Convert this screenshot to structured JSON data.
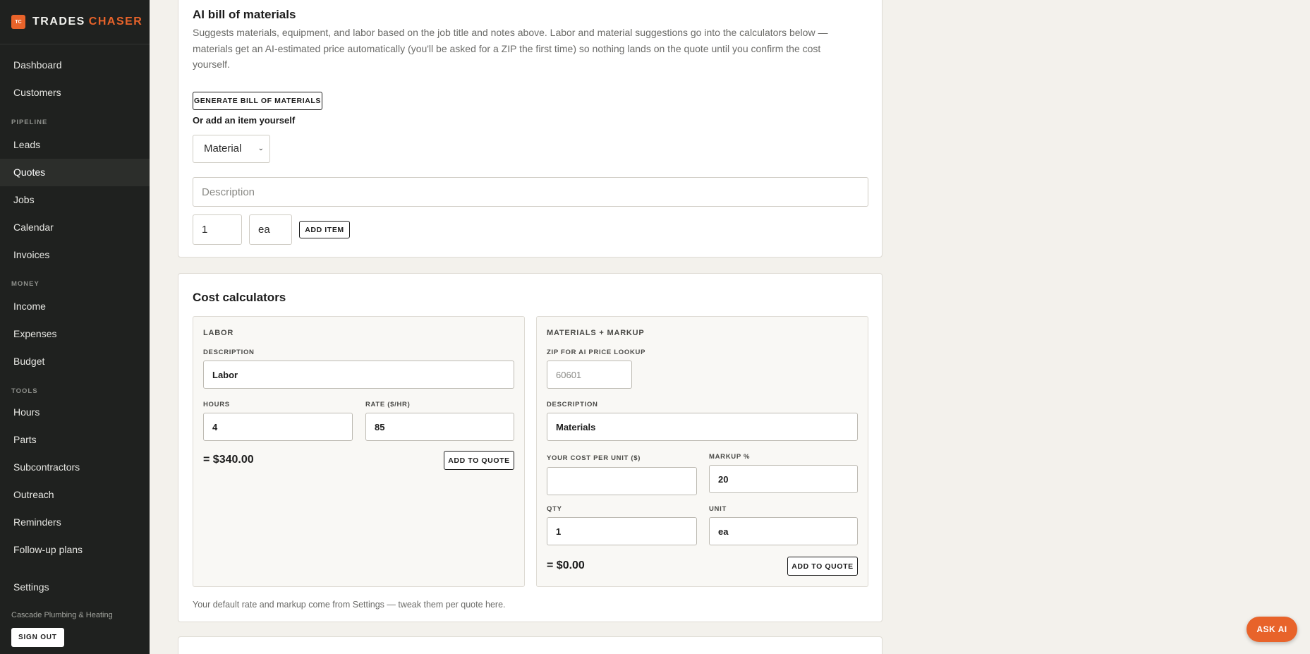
{
  "brand": {
    "logo_text": "TC",
    "name_part1": "TRADES",
    "name_part2": "CHASER",
    "accent_color": "#e8632a"
  },
  "sidebar": {
    "items": [
      {
        "label": "Dashboard"
      },
      {
        "label": "Customers"
      },
      {
        "label": "Leads"
      },
      {
        "label": "Quotes",
        "active": true
      },
      {
        "label": "Jobs"
      },
      {
        "label": "Calendar"
      },
      {
        "label": "Invoices"
      },
      {
        "label": "Income"
      },
      {
        "label": "Expenses"
      },
      {
        "label": "Budget"
      },
      {
        "label": "Hours"
      },
      {
        "label": "Parts"
      },
      {
        "label": "Subcontractors"
      },
      {
        "label": "Outreach"
      },
      {
        "label": "Reminders"
      },
      {
        "label": "Follow-up plans"
      },
      {
        "label": "Settings"
      }
    ],
    "sections": {
      "pipeline": "PIPELINE",
      "money": "MONEY",
      "tools": "TOOLS"
    },
    "company": "Cascade Plumbing & Heating",
    "sign_out": "SIGN OUT"
  },
  "bom": {
    "title": "AI bill of materials",
    "description": "Suggests materials, equipment, and labor based on the job title and notes above. Labor and material suggestions go into the calculators below — materials get an AI-estimated price automatically (you'll be asked for a ZIP the first time) so nothing lands on the quote until you confirm the cost yourself.",
    "generate_button": "GENERATE BILL OF MATERIALS",
    "add_yourself_label": "Or add an item yourself",
    "type_selected": "Material",
    "description_placeholder": "Description",
    "qty_value": "1",
    "unit_value": "ea",
    "add_item_button": "ADD ITEM"
  },
  "calculators": {
    "title": "Cost calculators",
    "labor": {
      "title": "LABOR",
      "description_label": "DESCRIPTION",
      "description_value": "Labor",
      "hours_label": "HOURS",
      "hours_value": "4",
      "rate_label": "RATE ($/HR)",
      "rate_value": "85",
      "total": "= $340.00",
      "add_button": "ADD TO QUOTE"
    },
    "materials": {
      "title": "MATERIALS + MARKUP",
      "zip_label": "ZIP FOR AI PRICE LOOKUP",
      "zip_placeholder": "60601",
      "description_label": "DESCRIPTION",
      "description_value": "Materials",
      "cost_label": "YOUR COST PER UNIT ($)",
      "cost_value": "",
      "markup_label": "MARKUP %",
      "markup_value": "20",
      "qty_label": "QTY",
      "qty_value": "1",
      "unit_label": "UNIT",
      "unit_value": "ea",
      "total": "= $0.00",
      "add_button": "ADD TO QUOTE"
    },
    "footnote": "Your default rate and markup come from Settings — tweak them per quote here."
  },
  "ask_ai": "ASK AI"
}
